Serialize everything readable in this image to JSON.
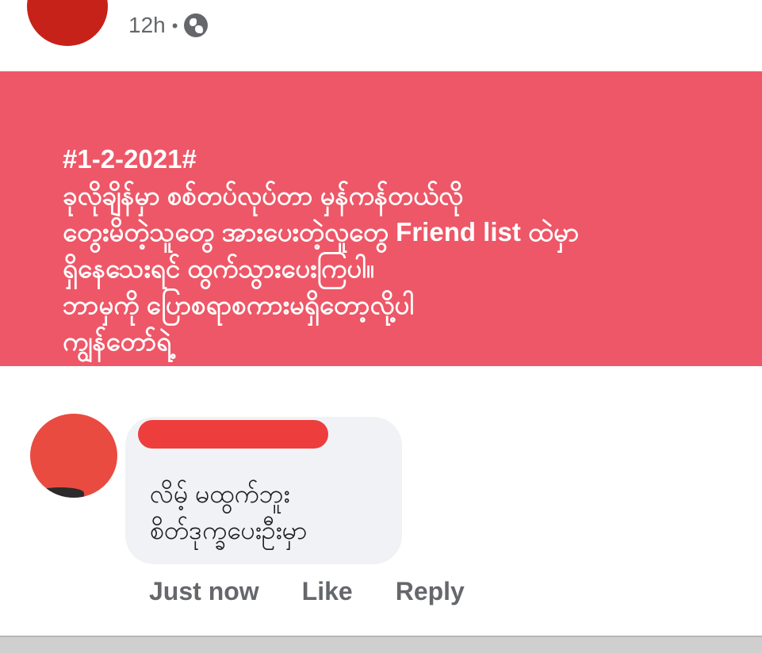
{
  "post": {
    "meta": {
      "time": "12h",
      "separator": "•",
      "privacy_icon": "globe-icon"
    },
    "background_color": "#ee5767",
    "lines": [
      "#1-2-2021#",
      "ခုလိုချိန်မှာ စစ်တပ်လုပ်တာ မှန်ကန်တယ်လို",
      "တွေးမိတဲ့သူတွေ အားပေးတဲ့လူတွေ Friend list ထဲမှာ",
      "ရှိနေသေးရင် ထွက်သွားပေးကြပါ။",
      "ဘာမှကို ပြောစရာစကားမရှိတော့လို့ပါ",
      "ကျွန်တော်ရဲ့"
    ]
  },
  "comment": {
    "author_redacted": true,
    "lines": [
      "လိမ့် မထွက်ဘူး",
      "စိတ်ဒုက္ခပေးဦးမှာ"
    ],
    "actions": {
      "time": "Just now",
      "like": "Like",
      "reply": "Reply"
    }
  }
}
